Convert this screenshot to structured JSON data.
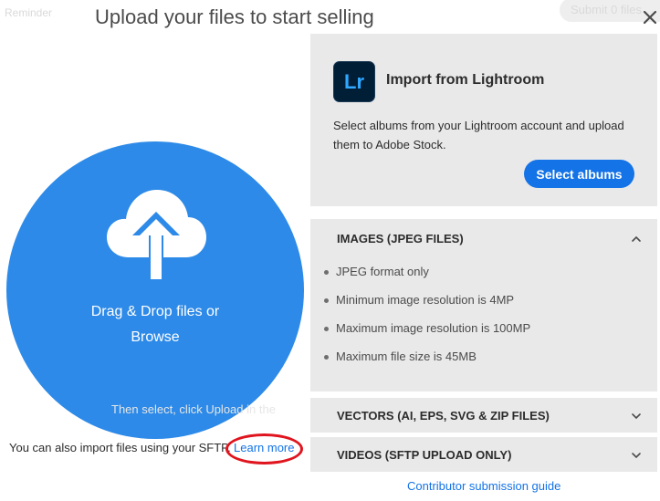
{
  "background": {
    "reminder": "Reminder",
    "submit_pill": "Submit 0 files",
    "ghost_hint": "Then select, click Upload in the"
  },
  "title": "Upload your files to start selling",
  "dropzone": {
    "line1": "Drag & Drop files or",
    "line2": "Browse"
  },
  "sftp": {
    "text": "You can also import files using your SFTP.",
    "link": "Learn more"
  },
  "lightroom": {
    "logo": "Lr",
    "title": "Import from Lightroom",
    "description": "Select albums from your Lightroom account and upload them to Adobe Stock.",
    "button": "Select albums"
  },
  "sections": {
    "images": {
      "title": "IMAGES (JPEG FILES)",
      "expanded": true,
      "items": [
        "JPEG format only",
        "Minimum image resolution is 4MP",
        "Maximum image resolution is 100MP",
        "Maximum file size is 45MB"
      ]
    },
    "vectors": {
      "title": "VECTORS (AI, EPS, SVG & ZIP FILES)",
      "expanded": false
    },
    "videos": {
      "title": "VIDEOS (SFTP UPLOAD ONLY)",
      "expanded": false
    }
  },
  "guide_link": "Contributor submission guide",
  "colors": {
    "accent": "#1473e6",
    "dropzone": "#2d8ae8",
    "panel": "#e9e9e9",
    "highlight_ring": "#e0141e"
  }
}
